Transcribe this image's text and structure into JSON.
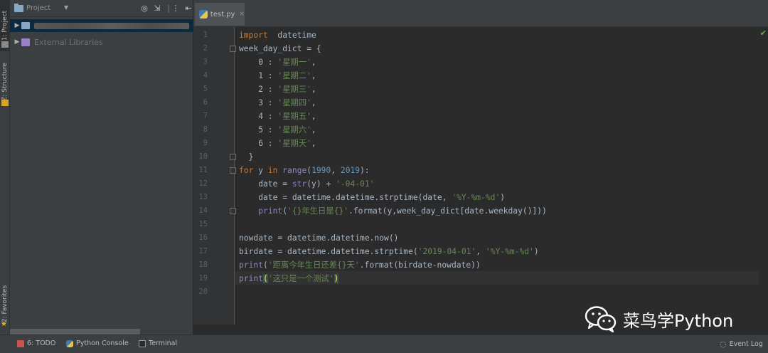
{
  "side_tabs": {
    "project": "1: Project",
    "structure": "Z: Structure",
    "favorites": "2: Favorites"
  },
  "project_panel": {
    "title": "Project",
    "tree": [
      {
        "label": "",
        "blurred": true
      },
      {
        "label": "External Libraries"
      }
    ]
  },
  "editor": {
    "tab": {
      "label": "test.py",
      "close": "×"
    },
    "line_numbers": [
      "1",
      "2",
      "3",
      "4",
      "5",
      "6",
      "7",
      "8",
      "9",
      "10",
      "11",
      "12",
      "13",
      "14",
      "15",
      "16",
      "17",
      "18",
      "19",
      "20"
    ],
    "lines": [
      [
        [
          "kw",
          "import"
        ],
        [
          "",
          "  datetime"
        ]
      ],
      [
        [
          "",
          "week_day_dict = {"
        ]
      ],
      [
        [
          "",
          "    0 : "
        ],
        [
          "str",
          "'星期一'"
        ],
        [
          "",
          ","
        ]
      ],
      [
        [
          "",
          "    1 : "
        ],
        [
          "str",
          "'星期二'"
        ],
        [
          "",
          ","
        ]
      ],
      [
        [
          "",
          "    2 : "
        ],
        [
          "str",
          "'星期三'"
        ],
        [
          "",
          ","
        ]
      ],
      [
        [
          "",
          "    3 : "
        ],
        [
          "str",
          "'星期四'"
        ],
        [
          "",
          ","
        ]
      ],
      [
        [
          "",
          "    4 : "
        ],
        [
          "str",
          "'星期五'"
        ],
        [
          "",
          ","
        ]
      ],
      [
        [
          "",
          "    5 : "
        ],
        [
          "str",
          "'星期六'"
        ],
        [
          "",
          ","
        ]
      ],
      [
        [
          "",
          "    6 : "
        ],
        [
          "str",
          "'星期天'"
        ],
        [
          "",
          ","
        ]
      ],
      [
        [
          "",
          "  }"
        ]
      ],
      [
        [
          "kw",
          "for"
        ],
        [
          "",
          " y "
        ],
        [
          "kw",
          "in"
        ],
        [
          "",
          " "
        ],
        [
          "bi",
          "range"
        ],
        [
          "",
          "("
        ],
        [
          "num",
          "1990"
        ],
        [
          "",
          ", "
        ],
        [
          "num",
          "2019"
        ],
        [
          "",
          "):"
        ]
      ],
      [
        [
          "",
          "    date = "
        ],
        [
          "bi",
          "str"
        ],
        [
          "",
          "(y) + "
        ],
        [
          "str",
          "'-04-01'"
        ]
      ],
      [
        [
          "",
          "    date = datetime.datetime.strptime(date, "
        ],
        [
          "str",
          "'%Y-%m-%d'"
        ],
        [
          "",
          ")"
        ]
      ],
      [
        [
          "",
          "    "
        ],
        [
          "bi",
          "print"
        ],
        [
          "",
          "("
        ],
        [
          "str",
          "'{}年生日是{}'"
        ],
        [
          "",
          ".format(y,week_day_dict[date.weekday()]))"
        ]
      ],
      [
        [
          "",
          ""
        ]
      ],
      [
        [
          "",
          "nowdate = datetime.datetime.now()"
        ]
      ],
      [
        [
          "",
          "birdate = datetime.datetime.strptime("
        ],
        [
          "str",
          "'2019-04-01'"
        ],
        [
          "",
          ", "
        ],
        [
          "str",
          "'%Y-%m-%d'"
        ],
        [
          "",
          ")"
        ]
      ],
      [
        [
          "bi",
          "print"
        ],
        [
          "",
          "("
        ],
        [
          "str",
          "'距离今年生日还差{}天'"
        ],
        [
          "",
          ".format(birdate-nowdate))"
        ]
      ],
      [
        [
          "bi",
          "print"
        ],
        [
          "brh",
          "("
        ],
        [
          "str",
          "'这只是一个测试'"
        ],
        [
          "brh",
          ")"
        ]
      ],
      [
        [
          "",
          ""
        ]
      ]
    ]
  },
  "watermark": {
    "text": "菜鸟学Python"
  },
  "bottom_bar": {
    "todo": "6: TODO",
    "python_console": "Python Console",
    "terminal": "Terminal",
    "event_log": "Event Log"
  },
  "colors": {
    "keyword": "#cc7832",
    "string": "#6a8759",
    "number": "#6897bb",
    "builtin": "#8888c6",
    "text": "#a9b7c6",
    "background": "#2b2b2b"
  }
}
